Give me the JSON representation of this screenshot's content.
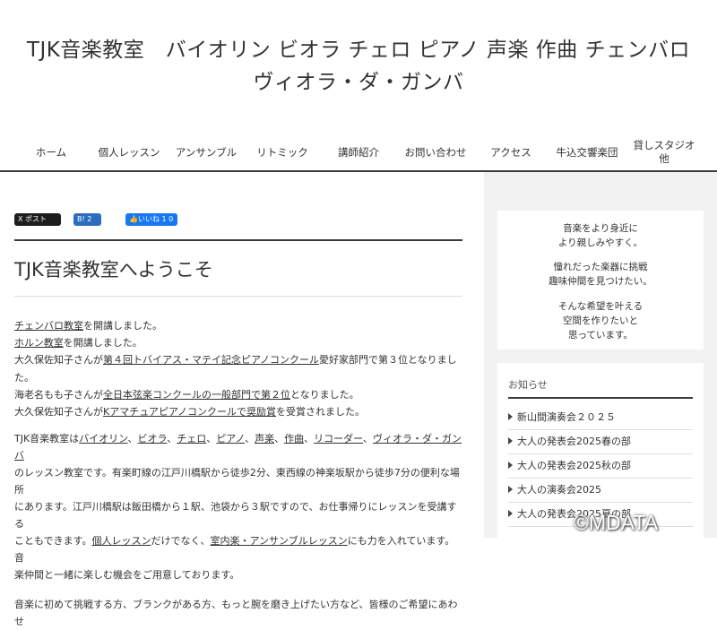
{
  "header": {
    "title_line1": "TJK音楽教室　バイオリン ビオラ チェロ ピアノ 声楽 作曲 チェンバロ",
    "title_line2": "ヴィオラ・ダ・ガンバ"
  },
  "nav": {
    "items": [
      {
        "label": "ホーム"
      },
      {
        "label": "個人レッスン"
      },
      {
        "label": "アンサンブル"
      },
      {
        "label": "リトミック"
      },
      {
        "label": "講師紹介"
      },
      {
        "label": "お問い合わせ"
      },
      {
        "label": "アクセス"
      },
      {
        "label": "牛込交響楽団"
      },
      {
        "label": "貸しスタジオ他"
      }
    ]
  },
  "share": {
    "x_label": "X ポスト",
    "hatena_label": "B! 2",
    "fb_label": "いいね 1 0"
  },
  "page": {
    "heading": "TJK音楽教室へようこそ"
  },
  "news": {
    "line1_link": "チェンバロ教室",
    "line1_rest": "を開講しました。",
    "line2_link": "ホルン教室",
    "line2_rest": "を開講しました。",
    "line3_pre": "大久保佐知子さんが",
    "line3_link": "第４回トバイアス・マテイ記念ピアノコンクール",
    "line3_rest": "愛好家部門で第３位となりまし",
    "line3_cont": "た。",
    "line4_pre": "海老名もも子さんが",
    "line4_link": "全日本弦楽コンクールの一般部門で第２位",
    "line4_rest": "となりました。",
    "line5_pre": "大久保佐知子さんが",
    "line5_link": "Kアマチュアピアノコンクールで奨励賞",
    "line5_rest": "を受賞されました。"
  },
  "intro": {
    "p1_pre": "TJK音楽教室は",
    "links": [
      "バイオリン",
      "ビオラ",
      "チェロ",
      "ピアノ",
      "声楽",
      "作曲",
      "リコーダー",
      "ヴィオラ・ダ・ガンバ"
    ],
    "sep": "、",
    "p1_line2": "のレッスン教室です。有楽町線の江戸川橋駅から徒歩2分、東西線の神楽坂駅から徒歩7分の便利な場所",
    "p1_line3": "にあります。江戸川橋駅は飯田橋から１駅、池袋から３駅ですので、お仕事帰りにレッスンを受講する",
    "p1_line4_pre": "こともできます。",
    "p1_link_individual": "個人レッスン",
    "p1_line4_mid": "だけでなく、",
    "p1_link_ensemble": "室内楽・アンサンブルレッスン",
    "p1_line4_rest": "にも力を入れています。音",
    "p1_line5": "楽仲間と一緒に楽しむ機会をご用意しております。",
    "p2": "音楽に初めて挑戦する方、ブランクがある方、もっと腕を磨き上げたい方など、皆様のご希望にあわせ"
  },
  "sidebar": {
    "msg1_a": "音楽をより身近に",
    "msg1_b": "より親しみやすく。",
    "msg2_a": "憧れだった楽器に挑戦",
    "msg2_b": "趣味仲間を見つけたい。",
    "msg3_a": "そんな希望を叶える",
    "msg3_b": "空間を作りたいと",
    "msg3_c": "思っています。",
    "notice_title": "お知らせ",
    "notices": [
      {
        "label": "新山間演奏会２０２５"
      },
      {
        "label": "大人の発表会2025春の部"
      },
      {
        "label": "大人の発表会2025秋の部"
      },
      {
        "label": "大人の演奏会2025"
      },
      {
        "label": "大人の発表会2025夏の部"
      }
    ]
  },
  "watermark": "©MDATA"
}
